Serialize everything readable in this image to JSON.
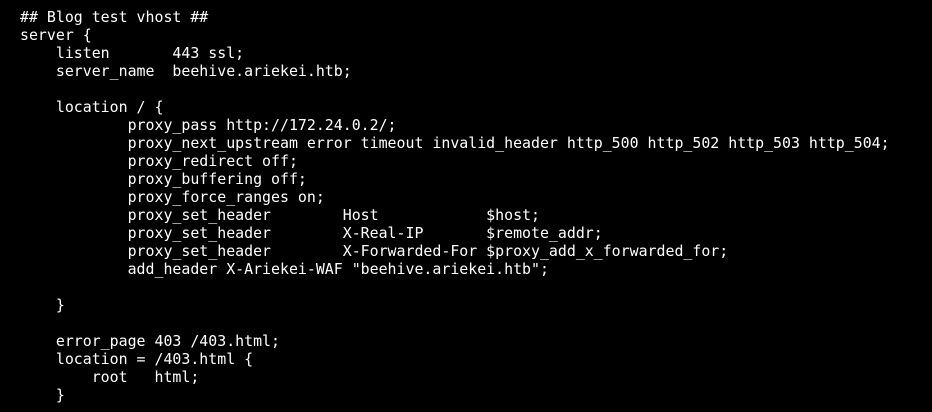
{
  "terminal": {
    "lines": [
      "## Blog test vhost ##",
      "server {",
      "    listen       443 ssl;",
      "    server_name  beehive.ariekei.htb;",
      "",
      "    location / {",
      "            proxy_pass http://172.24.0.2/;",
      "            proxy_next_upstream error timeout invalid_header http_500 http_502 http_503 http_504;",
      "            proxy_redirect off;",
      "            proxy_buffering off;",
      "            proxy_force_ranges on;",
      "            proxy_set_header        Host            $host;",
      "            proxy_set_header        X-Real-IP       $remote_addr;",
      "            proxy_set_header        X-Forwarded-For $proxy_add_x_forwarded_for;",
      "            add_header X-Ariekei-WAF \"beehive.ariekei.htb\";",
      "",
      "    }",
      "",
      "    error_page 403 /403.html;",
      "    location = /403.html {",
      "        root   html;",
      "    }"
    ]
  }
}
